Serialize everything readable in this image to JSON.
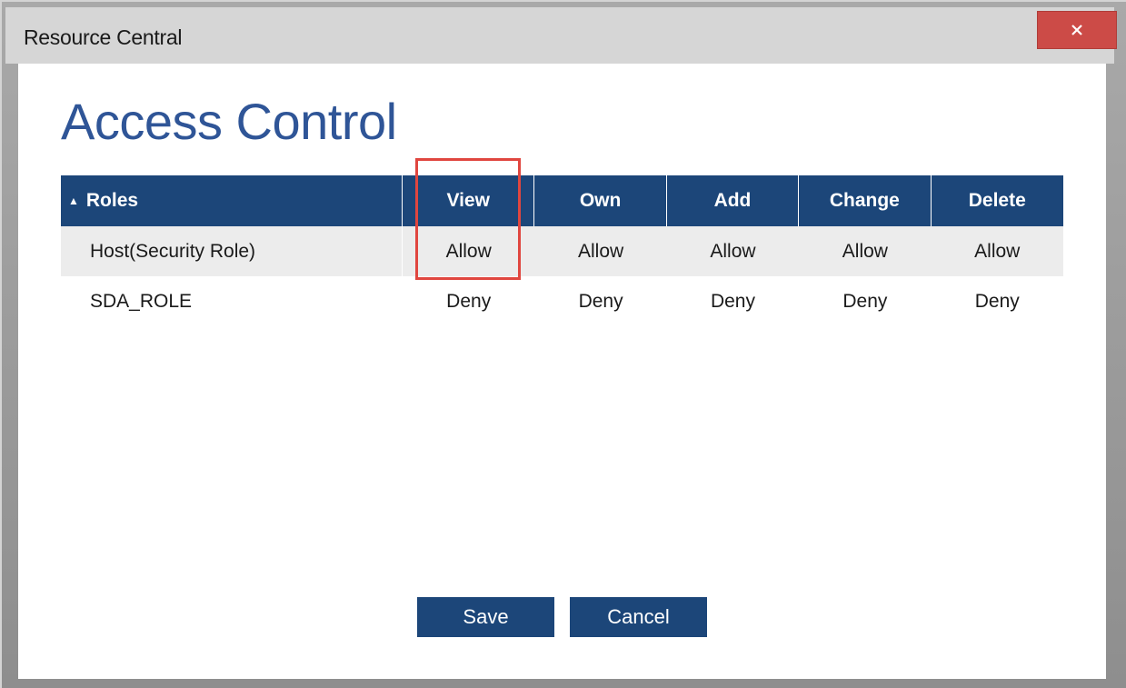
{
  "window": {
    "title": "Resource Central",
    "close_glyph": "×"
  },
  "page": {
    "heading": "Access Control"
  },
  "grid": {
    "columns": {
      "roles": "Roles",
      "perms": [
        "View",
        "Own",
        "Add",
        "Change",
        "Delete"
      ]
    },
    "sort_indicator": "▲",
    "rows": [
      {
        "role": "Host(Security Role)",
        "perms": [
          "Allow",
          "Allow",
          "Allow",
          "Allow",
          "Allow"
        ]
      },
      {
        "role": "SDA_ROLE",
        "perms": [
          "Deny",
          "Deny",
          "Deny",
          "Deny",
          "Deny"
        ]
      }
    ]
  },
  "actions": {
    "save_label": "Save",
    "cancel_label": "Cancel"
  },
  "colors": {
    "header_bg": "#1c4679",
    "heading_text": "#2f5597",
    "close_bg": "#cc4b47",
    "highlight_border": "#e0463f",
    "alt_row_bg": "#ececec"
  }
}
